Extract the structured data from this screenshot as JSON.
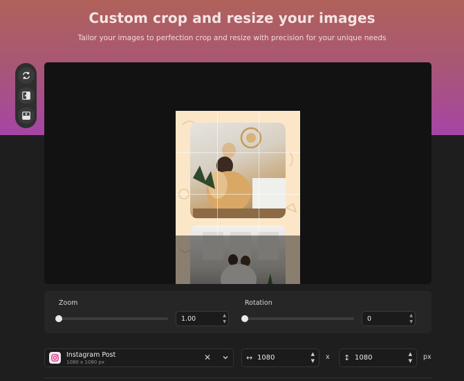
{
  "header": {
    "title": "Custom crop and resize your images",
    "subtitle": "Tailor your images to perfection crop and resize with precision for your unique needs"
  },
  "toolbar": {
    "tools": [
      {
        "icon": "rotate-icon"
      },
      {
        "icon": "flip-horizontal-icon"
      },
      {
        "icon": "flip-vertical-icon"
      }
    ]
  },
  "controls": {
    "zoom": {
      "label": "Zoom",
      "value": "1.00",
      "level": 0.0
    },
    "rotation": {
      "label": "Rotation",
      "value": "0",
      "level": 0.0
    }
  },
  "preset": {
    "name": "Instagram Post",
    "size": "1080 x 1080 px",
    "icon": "instagram-icon"
  },
  "dimensions": {
    "width": "1080",
    "height": "1080",
    "separator": "x",
    "unit": "px"
  },
  "colors": {
    "hero_top": "#b0625a",
    "hero_bottom": "#a645a6",
    "background": "#1e1e1e",
    "canvas": "#121212"
  }
}
